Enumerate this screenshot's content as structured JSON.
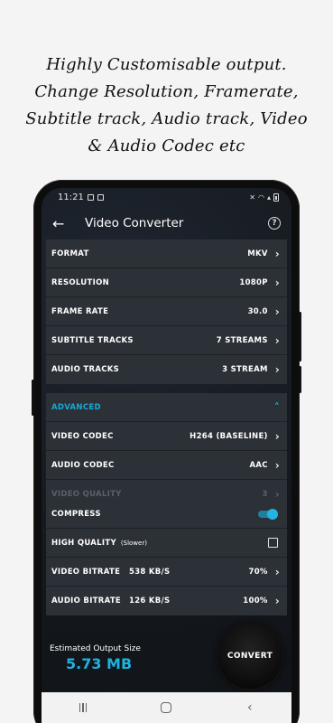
{
  "headline": [
    "Highly Customisable output.",
    "Change Resolution, Framerate,",
    "Subtitle track, Audio track, Video",
    "& Audio Codec etc"
  ],
  "status": {
    "time": "11:21"
  },
  "appbar": {
    "title": "Video Converter",
    "back_icon": "arrow-left-icon",
    "help_icon": "help-circle-icon"
  },
  "settings": [
    {
      "label": "FORMAT",
      "value": "MKV"
    },
    {
      "label": "RESOLUTION",
      "value": "1080P"
    },
    {
      "label": "FRAME RATE",
      "value": "30.0"
    },
    {
      "label": "SUBTITLE TRACKS",
      "value": "7 STREAMS"
    },
    {
      "label": "AUDIO TRACKS",
      "value": "3 STREAM"
    }
  ],
  "advanced": {
    "header": "ADVANCED",
    "rows": [
      {
        "label": "VIDEO CODEC",
        "value": "H264 (BASELINE)"
      },
      {
        "label": "AUDIO CODEC",
        "value": "AAC"
      },
      {
        "label": "VIDEO QUALITY",
        "value": "3"
      }
    ]
  },
  "compress": {
    "label": "COMPRESS",
    "enabled": true,
    "high_quality_label": "HIGH QUALITY",
    "high_quality_note": "(Slower)",
    "high_quality_checked": false,
    "video_bitrate": {
      "label": "VIDEO BITRATE",
      "rate": "538 KB/S",
      "percent": "70%"
    },
    "audio_bitrate": {
      "label": "AUDIO BITRATE",
      "rate": "126 KB/S",
      "percent": "100%"
    }
  },
  "output": {
    "label": "Estimated Output Size",
    "size": "5.73 MB"
  },
  "convert_label": "CONVERT",
  "colors": {
    "accent": "#1fb2e0",
    "card": "#2c3137",
    "background": "#f4f4f4"
  }
}
